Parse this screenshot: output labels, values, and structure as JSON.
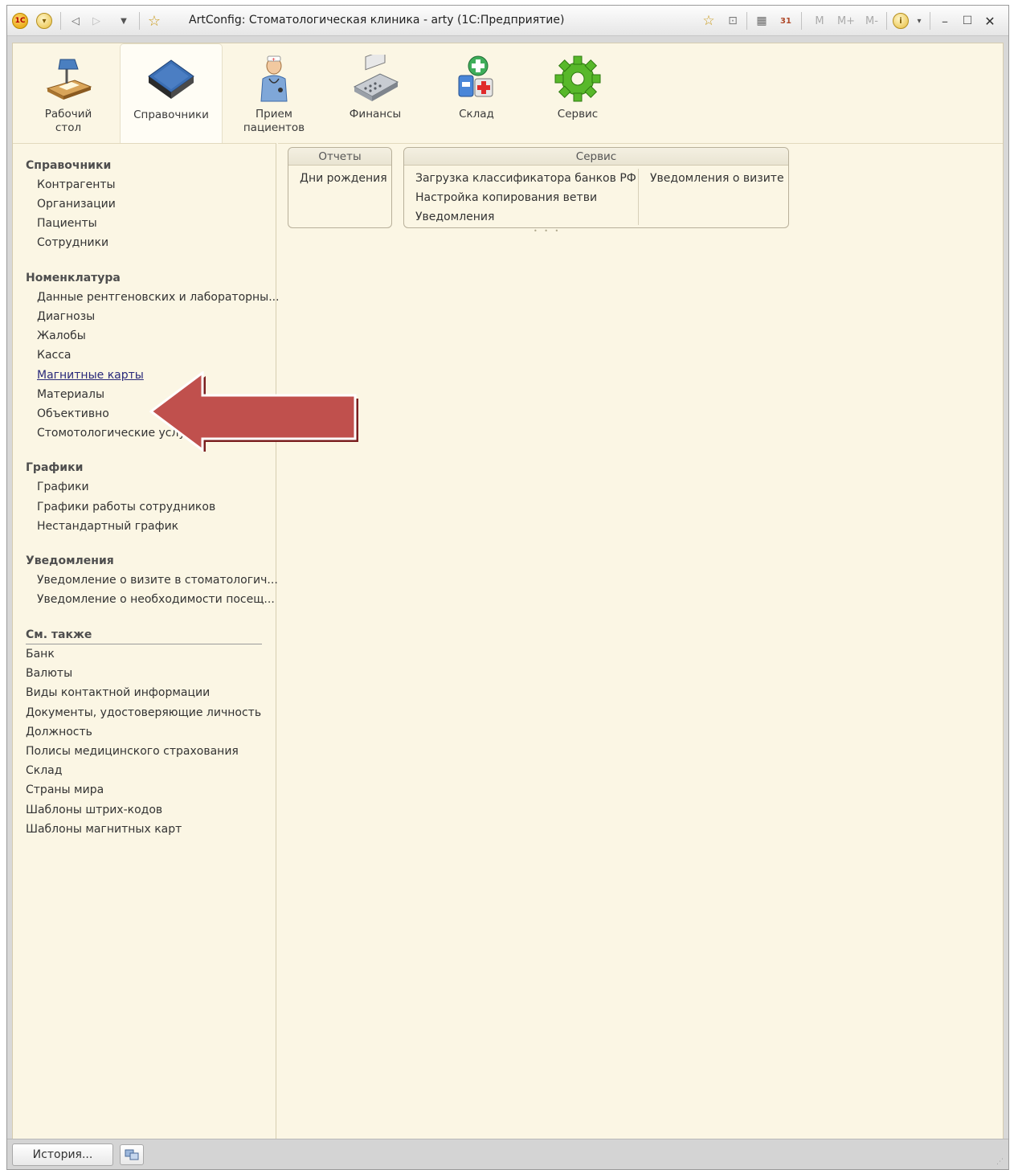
{
  "window": {
    "title": "ArtConfig: Стоматологическая клиника - arty  (1С:Предприятие)",
    "logo_text": "1С",
    "toolbar_right": [
      "M",
      "M+",
      "M-"
    ]
  },
  "sections": [
    {
      "label": "Рабочий\nстол"
    },
    {
      "label": "Справочники"
    },
    {
      "label": "Прием\nпациентов"
    },
    {
      "label": "Финансы"
    },
    {
      "label": "Склад"
    },
    {
      "label": "Сервис"
    }
  ],
  "nav": {
    "groups": [
      {
        "title": "Справочники",
        "items": [
          "Контрагенты",
          "Организации",
          "Пациенты",
          "Сотрудники"
        ]
      },
      {
        "title": "Номенклатура",
        "items": [
          "Данные рентгеновских и лабораторны...",
          "Диагнозы",
          "Жалобы",
          "Касса",
          "Магнитные карты",
          "Материалы",
          "Объективно",
          "Стомотологические услуги (работы)"
        ]
      },
      {
        "title": "Графики",
        "items": [
          "Графики",
          "Графики работы сотрудников",
          "Нестандартный график"
        ]
      },
      {
        "title": "Уведомления",
        "items": [
          "Уведомление о визите в стоматологич...",
          "Уведомление о необходимости посещ..."
        ]
      }
    ],
    "see_also": {
      "title": "См. также",
      "items": [
        "Банк",
        "Валюты",
        "Виды контактной информации",
        "Документы, удостоверяющие личность",
        "Должность",
        "Полисы медицинского страхования",
        "Склад",
        "Страны мира",
        "Шаблоны штрих-кодов",
        "Шаблоны магнитных карт"
      ]
    }
  },
  "panels": {
    "reports": {
      "title": "Отчеты",
      "items": [
        "Дни рождения"
      ]
    },
    "service": {
      "title": "Сервис",
      "col1": [
        "Загрузка классификатора банков РФ",
        "Настройка копирования ветви",
        "Уведомления"
      ],
      "col2": [
        "Уведомления о визите"
      ]
    }
  },
  "statusbar": {
    "history_label": "История..."
  },
  "colors": {
    "background": "#fbf6e4",
    "arrow": "#c0504d",
    "arrow_outline": "#7a1f1f"
  }
}
